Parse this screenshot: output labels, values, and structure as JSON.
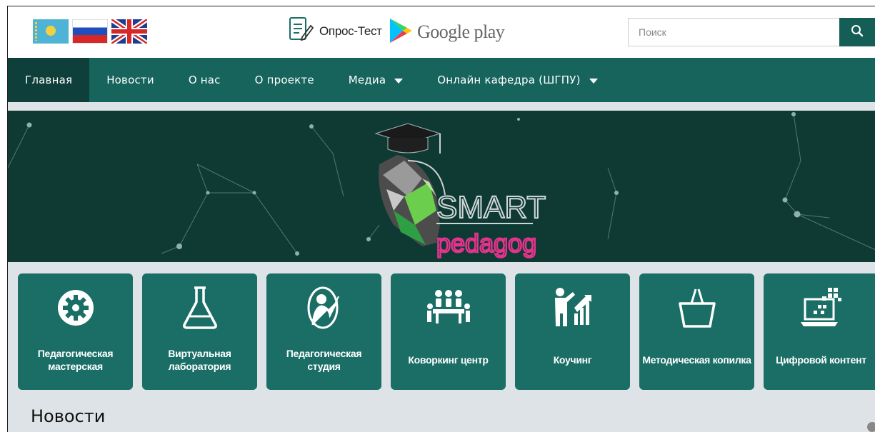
{
  "topbar": {
    "opros_label": "Опрос-Тест",
    "gplay_label": "Google play",
    "search_placeholder": "Поиск"
  },
  "nav": {
    "items": [
      {
        "label": "Главная"
      },
      {
        "label": "Новости"
      },
      {
        "label": "О нас"
      },
      {
        "label": "О проекте"
      },
      {
        "label": "Медиа"
      },
      {
        "label": "Онлайн кафедра (ШГПУ)"
      }
    ]
  },
  "banner": {
    "logo_main": "SMART",
    "logo_sub": "pedagog"
  },
  "tiles": [
    {
      "label": "Педагогическая мастерская",
      "icon": "gear-icon"
    },
    {
      "label": "Виртуальная лаборатория",
      "icon": "flask-icon"
    },
    {
      "label": "Педагогическая студия",
      "icon": "teacher-icon"
    },
    {
      "label": "Коворкинг центр",
      "icon": "meeting-icon"
    },
    {
      "label": "Коучинг",
      "icon": "coaching-icon"
    },
    {
      "label": "Методическая копилка",
      "icon": "basket-icon"
    },
    {
      "label": "Цифровой контент",
      "icon": "laptop-icon"
    }
  ],
  "news": {
    "title": "Новости"
  },
  "colors": {
    "primary": "#16645c",
    "nav_active": "#0f3f3a",
    "banner_bg": "#0f3a34",
    "tile_bg": "#1a6e66",
    "page_bg": "#dde3e6"
  }
}
